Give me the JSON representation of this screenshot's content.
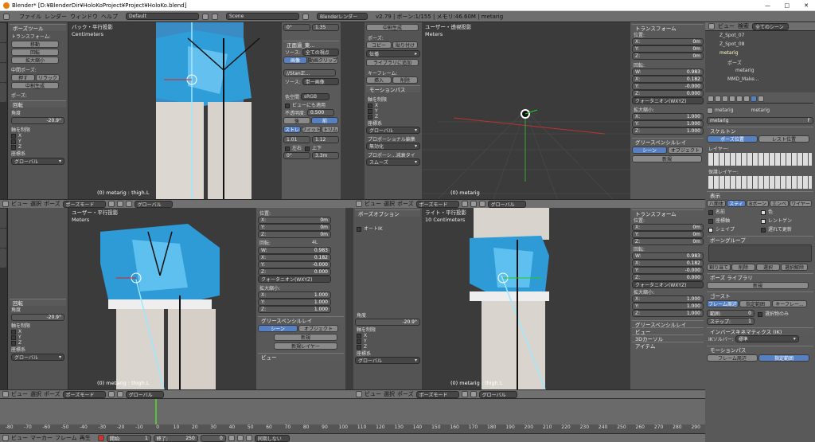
{
  "titlebar": {
    "title": "Blender* [D:¥BlenderDir¥HoloKoProject¥Project¥HoloKo.blend]",
    "min": "—",
    "max": "□",
    "close": "✕"
  },
  "menu": {
    "items": [
      "ファイル",
      "レンダー",
      "ウィンドウ",
      "ヘルプ"
    ],
    "layout": "Default",
    "scene": "Scene",
    "engine": "Blenderレンダー",
    "stats": "v2.79 | ボーン:1/155 | メモリ:46.60M | metarig"
  },
  "toolshelf": {
    "title": "ボーズツール",
    "transform_label": "トランスフォーム:",
    "move": "移動",
    "rotate": "回転",
    "scale": "拡大縮小",
    "mid_pose_label": "中間ポーズ:",
    "push": "押す",
    "relax": "リラック",
    "breakdown": "中割生成",
    "pose_label": "ポーズ:",
    "rotate_panel": "回転",
    "angle_label": "角度",
    "angle_value": "-20.9°",
    "axis_label": "軸を制限",
    "x": "X",
    "y": "Y",
    "z": "Z",
    "orient_label": "座標系",
    "orient_value": "グローバル"
  },
  "views": {
    "back": {
      "title": "バック・平行投影",
      "unit": "Centimeters",
      "footer": "(0) metarig : thigh.L"
    },
    "persp": {
      "title": "ユーザー・透視投影",
      "unit": "Meters",
      "footer": "(0) metarig"
    },
    "user": {
      "title": "ユーザー・平行投影",
      "unit": "Meters",
      "footer": "(0) metarig : thigh.L"
    },
    "right": {
      "title": "ライト・平行投影",
      "unit": "10 Centimeters",
      "footer": "(0) metarig : thigh.L"
    }
  },
  "viewheader": {
    "view": "ビュー",
    "select": "選択",
    "pose": "ポーズ",
    "mode": "ポーズモード",
    "orient": "グローバル"
  },
  "imgpanel": {
    "rot0": "0°",
    "val135": "1.35",
    "name": "正面過_東...",
    "source_label": "ソース:",
    "source": "単一画像",
    "frames_label": "全ての視点",
    "image": "画像",
    "movie": "動画クリップ",
    "file": "//Stan正...",
    "colorspace_label": "色空間",
    "colorspace": "sRGB",
    "view_use": "ビューにも適用",
    "opacity_label": "不透明度:",
    "opacity": "0.500",
    "back": "後",
    "front": "前",
    "stretch": "ストレ",
    "fit": "フィット",
    "crop": "トリム",
    "s1": "1.01",
    "s2": "1.12",
    "flipx": "左右",
    "flipy": "上下",
    "rot2": "0°",
    "val33": "3.3m"
  },
  "midpanel": {
    "breakdown": "中割生成",
    "pose_label": "ポーズ:",
    "copy": "コピー",
    "paste": "貼り付け",
    "propagate": "伝播",
    "addlib": "ライブラリに追加",
    "key_label": "キーフレーム:",
    "insert": "挿入",
    "delete": "削除",
    "motionpath": "モーションパス",
    "axis_label": "軸を制限",
    "x": "X",
    "y": "Y",
    "z": "Z",
    "orient_label": "座標系",
    "orient": "グローバル",
    "prop_label": "プロポーショナル編集",
    "disabled": "無効化",
    "prop_falloff": "プロポーシ...減衰タイ",
    "smooth": "スムーズ"
  },
  "npanel": {
    "transform": "トランスフォーム",
    "location": "位置:",
    "x": "X:",
    "y": "Y:",
    "z": "Z:",
    "loc": [
      "0m",
      "0m",
      "0m"
    ],
    "rotation": "回転:",
    "rw": "W:",
    "rot": [
      "0.983",
      "0.182",
      "-0.000",
      "0.000"
    ],
    "rotmode": "クォータニオン(WXYZ)",
    "scale": "拡大縮小:",
    "scl": [
      "1.000",
      "1.000",
      "1.000"
    ],
    "greasepencil": "グリースペンシルレイ",
    "scene": "シーン",
    "object": "オブジェクト",
    "new": "新規",
    "newlayer": "新規レイヤー",
    "view": "ビュー",
    "cursor": "3Dカーソル",
    "item": "アイテム",
    "ik": "ボーズオプション",
    "autoik": "オートIK",
    "rot4l": "4L"
  },
  "outliner": {
    "view": "ビュー",
    "search": "検索",
    "allscenes": "全てのシーン",
    "items": [
      "Z_Spot_07",
      "Z_Spot_08",
      "metarig",
      "ポーズ",
      "metarig",
      "MMD_Make..."
    ]
  },
  "props": {
    "obj": "metarig",
    "arm": "metarig",
    "armname": "metarig",
    "skeleton": "スケルトン",
    "posepos": "ポーズ位置",
    "restpos": "レスト位置",
    "layers": "レイヤー:",
    "protected": "保護レイヤー:",
    "display": "表示",
    "octa": "八面体",
    "stick": "スティ",
    "bbone": "Bボーン",
    "envelope": "エンベ",
    "wire": "ワイヤー",
    "names": "名前",
    "colors": "色",
    "axes": "座標軸",
    "xray": "レントゲン",
    "shapes": "シェイプ",
    "delayupdate": "遅れて更新",
    "bonegroups": "ボーングループ",
    "assign": "割り当て",
    "remove": "削除",
    "select": "選択",
    "deselect": "選択解除",
    "poselib": "ポーズ ライブラリ",
    "new": "新規",
    "ghost": "ゴースト",
    "aroundframe": "フレーム周辺",
    "inrange": "指定範囲",
    "keyframes": "キーフレー...",
    "range_label": "範囲:",
    "range": "0",
    "step_label": "ステップ:",
    "step": "1",
    "selonly": "選択物のみ",
    "ik": "インバースキネマティクス (IK)",
    "solver_label": "IKソルバー:",
    "solver": "標準",
    "motionpath": "モーションパス",
    "mp_around": "フレーム周辺",
    "mp_range": "指定範囲"
  },
  "timeline": {
    "ticks": [
      "-80",
      "-70",
      "-60",
      "-50",
      "-40",
      "-30",
      "-20",
      "-10",
      "0",
      "10",
      "20",
      "30",
      "40",
      "50",
      "60",
      "70",
      "80",
      "90",
      "100",
      "110",
      "120",
      "130",
      "140",
      "150",
      "160",
      "170",
      "180",
      "190",
      "200",
      "210",
      "220",
      "230",
      "240",
      "250",
      "260",
      "270",
      "280",
      "290"
    ],
    "view": "ビュー",
    "marker": "マーカー",
    "frame": "フレーム",
    "play": "再生",
    "start_label": "開始:",
    "start": "1",
    "end_label": "終了:",
    "end": "250",
    "current": "0",
    "sync": "同期しない"
  }
}
